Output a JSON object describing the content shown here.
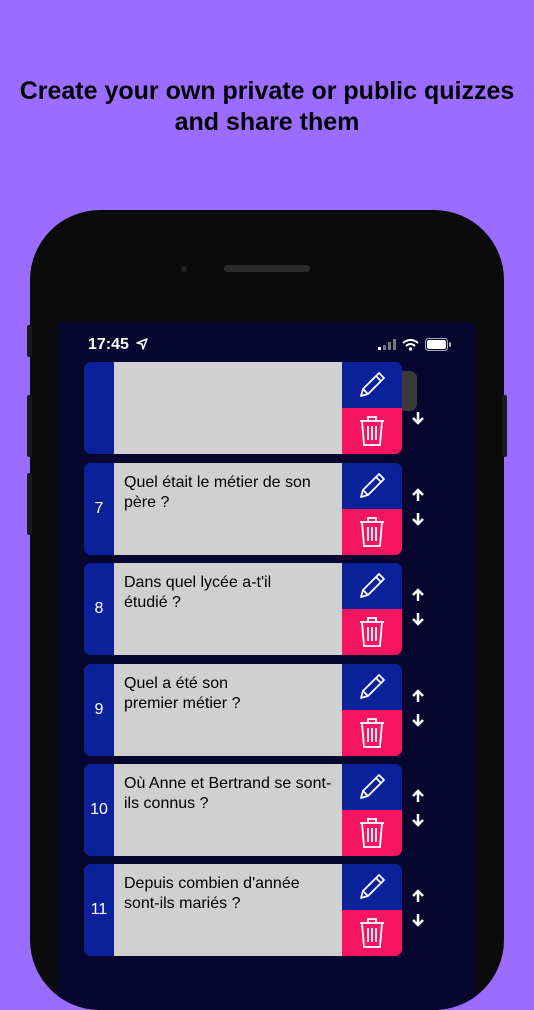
{
  "headline": "Create your own private or public quizzes and share them",
  "status": {
    "time": "17:45"
  },
  "tabs": [
    {
      "icon": "gear-icon",
      "active": false
    },
    {
      "icon": "question-icon",
      "active": true
    },
    {
      "icon": "eye-icon",
      "active": false
    }
  ],
  "questions": [
    {
      "number": "",
      "text": ""
    },
    {
      "number": "7",
      "text": "Quel était le métier de son père ?"
    },
    {
      "number": "8",
      "text": "Dans quel lycée a-t'il étudié ?"
    },
    {
      "number": "9",
      "text": "Quel a été son premier métier ?"
    },
    {
      "number": "10",
      "text": "Où Anne et Bertrand se sont-ils connus ?"
    },
    {
      "number": "11",
      "text": "Depuis combien d'année sont-ils mariés ?"
    }
  ],
  "colors": {
    "background": "#9a6cff",
    "screen": "#06062f",
    "accent_blue": "#0a2199",
    "delete_pink": "#f5145f",
    "question_bg": "#d0d0d0"
  }
}
